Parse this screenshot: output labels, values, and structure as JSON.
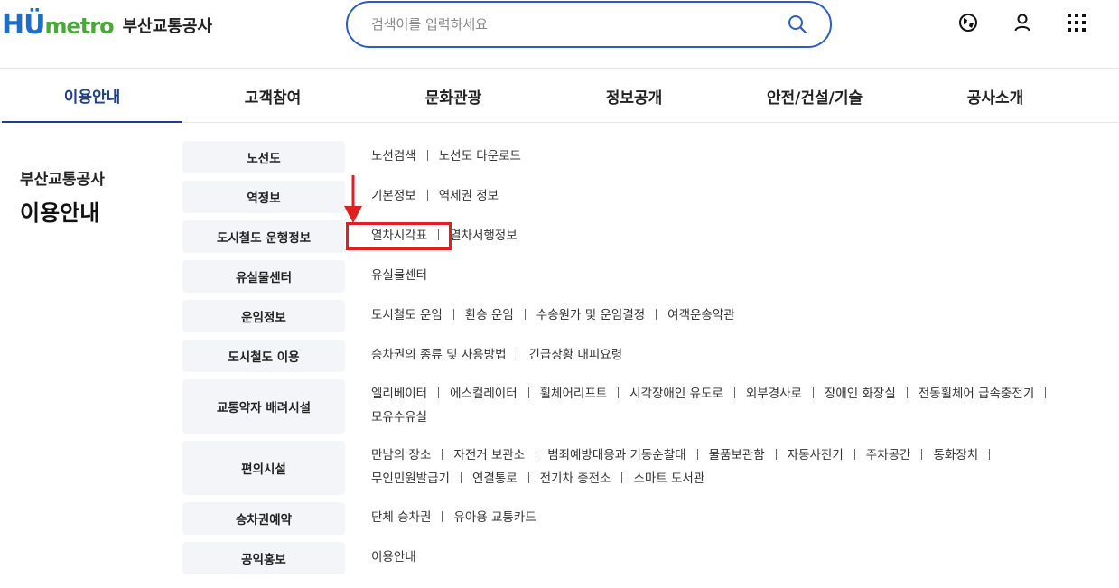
{
  "header": {
    "logo_mark": "HUmetro",
    "logo_name": "부산교통공사",
    "search_placeholder": "검색어를 입력하세요"
  },
  "icons": {
    "search": "search-icon",
    "language": "globe-icon",
    "user": "user-icon",
    "menu": "grid-menu-icon"
  },
  "colors": {
    "brand_blue": "#1a6fc9",
    "brand_green": "#4aa83a",
    "nav_active": "#1d3f8f",
    "highlight_red": "#e02020"
  },
  "gnb": [
    {
      "label": "이용안내"
    },
    {
      "label": "고객참여"
    },
    {
      "label": "문화관광"
    },
    {
      "label": "정보공개"
    },
    {
      "label": "안전/건설/기술"
    },
    {
      "label": "공사소개"
    }
  ],
  "side": {
    "sub": "부산교통공사",
    "title": "이용안내"
  },
  "menu": [
    {
      "category": "노선도",
      "links": [
        "노선검색",
        "노선도 다운로드"
      ]
    },
    {
      "category": "역정보",
      "links": [
        "기본정보",
        "역세권 정보"
      ]
    },
    {
      "category": "도시철도 운행정보",
      "links": [
        "열차시각표",
        "열차서행정보"
      ]
    },
    {
      "category": "유실물센터",
      "links": [
        "유실물센터"
      ]
    },
    {
      "category": "운임정보",
      "links": [
        "도시철도 운임",
        "환승 운임",
        "수송원가 및 운임결정",
        "여객운송약관"
      ]
    },
    {
      "category": "도시철도 이용",
      "links": [
        "승차권의 종류 및 사용방법",
        "긴급상황 대피요령"
      ]
    },
    {
      "category": "교통약자 배려시설",
      "links": [
        "엘리베이터",
        "에스컬레이터",
        "휠체어리프트",
        "시각장애인 유도로",
        "외부경사로",
        "장애인 화장실",
        "전동휠체어 급속충전기",
        "모유수유실"
      ]
    },
    {
      "category": "편의시설",
      "links": [
        "만남의 장소",
        "자전거 보관소",
        "범죄예방대응과 기동순찰대",
        "물품보관함",
        "자동사진기",
        "주차공간",
        "통화장치",
        "무인민원발급기",
        "연결통로",
        "전기차 충전소",
        "스마트 도서관"
      ]
    },
    {
      "category": "승차권예약",
      "links": [
        "단체 승차권",
        "유아용 교통카드"
      ]
    },
    {
      "category": "공익홍보",
      "links": [
        "이용안내"
      ]
    }
  ]
}
